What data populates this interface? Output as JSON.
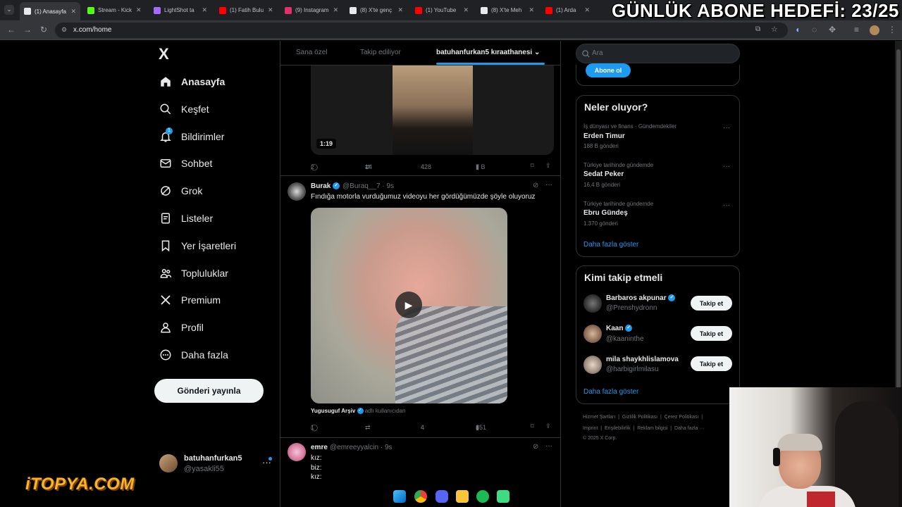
{
  "browser": {
    "tabs": [
      {
        "label": "(1) Anasayfa",
        "color": "#e7e9ea",
        "active": true
      },
      {
        "label": "Stream - Kick",
        "color": "#53fc18"
      },
      {
        "label": "LightShot ta",
        "color": "#a36bff"
      },
      {
        "label": "(1) Fatih Bulu",
        "color": "#ff0000"
      },
      {
        "label": "(9) Instagram",
        "color": "#e1306c"
      },
      {
        "label": "(8) X'te genç",
        "color": "#e7e9ea"
      },
      {
        "label": "(1) YouTube",
        "color": "#ff0000"
      },
      {
        "label": "(8) X'te Meh",
        "color": "#e7e9ea"
      },
      {
        "label": "(1) Arda",
        "color": "#ff0000"
      }
    ],
    "url": "x.com/home",
    "overlay_title": "GÜNLÜK ABONE HEDEFİ: 23/25"
  },
  "nav": {
    "logo": "X",
    "items": [
      {
        "label": "Anasayfa",
        "icon": "home-icon",
        "active": true
      },
      {
        "label": "Keşfet",
        "icon": "search-icon"
      },
      {
        "label": "Bildirimler",
        "icon": "bell-icon",
        "badge": "1"
      },
      {
        "label": "Sohbet",
        "icon": "mail-icon"
      },
      {
        "label": "Grok",
        "icon": "grok-icon"
      },
      {
        "label": "Listeler",
        "icon": "list-icon"
      },
      {
        "label": "Yer İşaretleri",
        "icon": "bookmark-icon"
      },
      {
        "label": "Topluluklar",
        "icon": "communities-icon"
      },
      {
        "label": "Premium",
        "icon": "premium-x-icon"
      },
      {
        "label": "Profil",
        "icon": "profile-icon"
      },
      {
        "label": "Daha fazla",
        "icon": "more-circle-icon"
      }
    ],
    "post_button": "Gönderi yayınla",
    "account": {
      "name": "batuhanfurkan5",
      "handle": "@yasakli55",
      "more": "···"
    }
  },
  "timeline": {
    "tabs": [
      "Sana özel",
      "Takip ediliyor",
      "batuhanfurkan5 kıraathanesi"
    ],
    "tweet1": {
      "duration": "1:19",
      "replies": "2",
      "reposts": "14",
      "likes": "428",
      "views": "7 B"
    },
    "tweet2": {
      "name": "Burak",
      "handle": "@Buraq__7",
      "time": "· 9s",
      "text": "Fındığa motorla vurduğumuz videoyu her gördüğümüzde şöyle oluyoruz",
      "source_name": "Yugusuguf Arşiv",
      "source_suffix": "adlı kullanıcıdan",
      "replies": "1",
      "reposts": "",
      "likes": "4",
      "views": "851"
    },
    "tweet3": {
      "name": "emre",
      "handle": "@emreeyyalcin",
      "time": "· 9s",
      "lines": [
        "kız:",
        "biz:",
        "kız:"
      ]
    }
  },
  "sidebar": {
    "search_placeholder": "Ara",
    "subscribe": "Abone ol",
    "trends_title": "Neler oluyor?",
    "trends": [
      {
        "category": "İş dünyası ve finans · Gündemdekiler",
        "name": "Erden Timur",
        "count": "188 B gönderi"
      },
      {
        "category": "Türkiye tarihinde gündemde",
        "name": "Sedat Peker",
        "count": "16,4 B gönderi"
      },
      {
        "category": "Türkiye tarihinde gündemde",
        "name": "Ebru Gündeş",
        "count": "1.370 gönderi"
      }
    ],
    "show_more": "Daha fazla göster",
    "wtf_title": "Kimi takip etmeli",
    "wtf": [
      {
        "name": "Barbaros akpunar",
        "handle": "@Prenshydronn",
        "verified": true
      },
      {
        "name": "Kaan",
        "handle": "@kaaninthe",
        "verified": true
      },
      {
        "name": "mila shaykhlislamova",
        "handle": "@harbigirlmilasu",
        "verified": false
      }
    ],
    "follow_label": "Takip et",
    "footer_line1": [
      "Hizmet Şartları",
      "Gizlilik Politikası",
      "Çerez Politikası"
    ],
    "footer_line2": [
      "Imprint",
      "Erişilebilirlik",
      "Reklam bilgisi",
      "Daha fazla ···"
    ],
    "copyright": "© 2025 X Corp."
  },
  "stream": {
    "sponsor": "iTOPYA.COM"
  }
}
